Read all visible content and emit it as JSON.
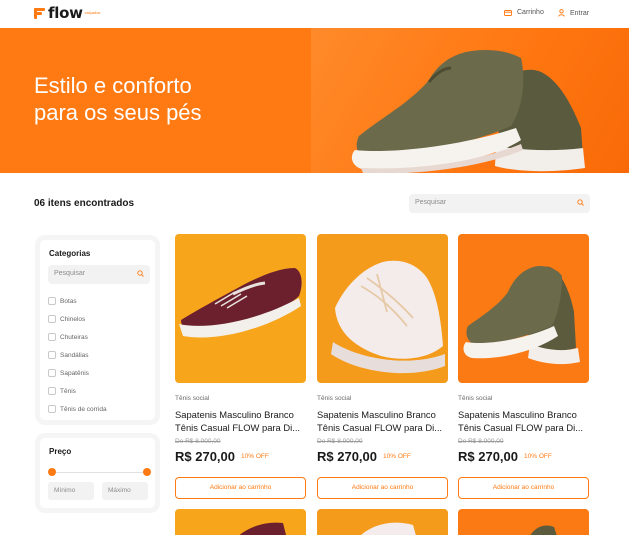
{
  "brand": {
    "name": "flow",
    "tagline": "calçados"
  },
  "header": {
    "cart_label": "Carrinho",
    "login_label": "Entrar"
  },
  "hero": {
    "title_line1": "Estilo e conforto",
    "title_line2": "para os seus pés"
  },
  "results": {
    "count_label": "06 itens encontrados",
    "search_placeholder": "Pesquisar"
  },
  "sidebar": {
    "categories_title": "Categorias",
    "category_search_placeholder": "Pesquisar",
    "categories": [
      "Botas",
      "Chinelos",
      "Chuteiras",
      "Sandálias",
      "Sapatênis",
      "Tênis",
      "Tênis de corrida"
    ],
    "price_title": "Preço",
    "min_placeholder": "Mínimo",
    "max_placeholder": "Máximo"
  },
  "products": [
    {
      "category": "Tênis social",
      "name": "Sapatenis Masculino Branco Tênis Casual FLOW para Di...",
      "old_price": "De R$ 8.000,00",
      "price": "R$ 270,00",
      "discount": "10% OFF",
      "button": "Adicionar ao carrinho"
    },
    {
      "category": "Tênis social",
      "name": "Sapatenis Masculino Branco Tênis Casual FLOW para Di...",
      "old_price": "De R$ 8.000,00",
      "price": "R$ 270,00",
      "discount": "10% OFF",
      "button": "Adicionar ao carrinho"
    },
    {
      "category": "Tênis social",
      "name": "Sapatenis Masculino Branco Tênis Casual FLOW para Di...",
      "old_price": "De R$ 8.000,00",
      "price": "R$ 270,00",
      "discount": "10% OFF",
      "button": "Adicionar ao carrinho"
    }
  ],
  "colors": {
    "accent": "#ff7a12",
    "panel_bg": "#f5f5f5",
    "text": "#1a1a1a"
  },
  "icons": {
    "cart": "cart-icon",
    "user": "user-icon",
    "search": "search-icon"
  }
}
